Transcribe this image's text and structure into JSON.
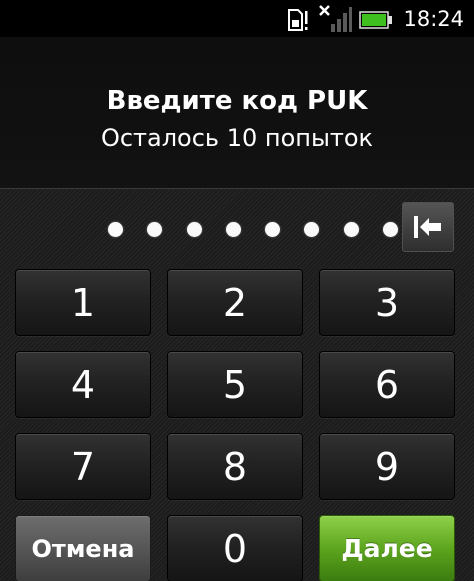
{
  "status_bar": {
    "time": "18:24",
    "icons": [
      "sim-card-alert-icon",
      "no-signal-icon",
      "battery-icon"
    ],
    "battery_color": "#3fbf1f"
  },
  "puk_screen": {
    "title": "Введите код PUK",
    "attempts": "Осталось 10 попыток",
    "entered_digits": 8
  },
  "keypad": {
    "keys": [
      "1",
      "2",
      "3",
      "4",
      "5",
      "6",
      "7",
      "8",
      "9"
    ],
    "zero": "0",
    "cancel_label": "Отмена",
    "next_label": "Далее",
    "backspace_icon": "backspace-icon",
    "next_color": "#5da51e"
  }
}
